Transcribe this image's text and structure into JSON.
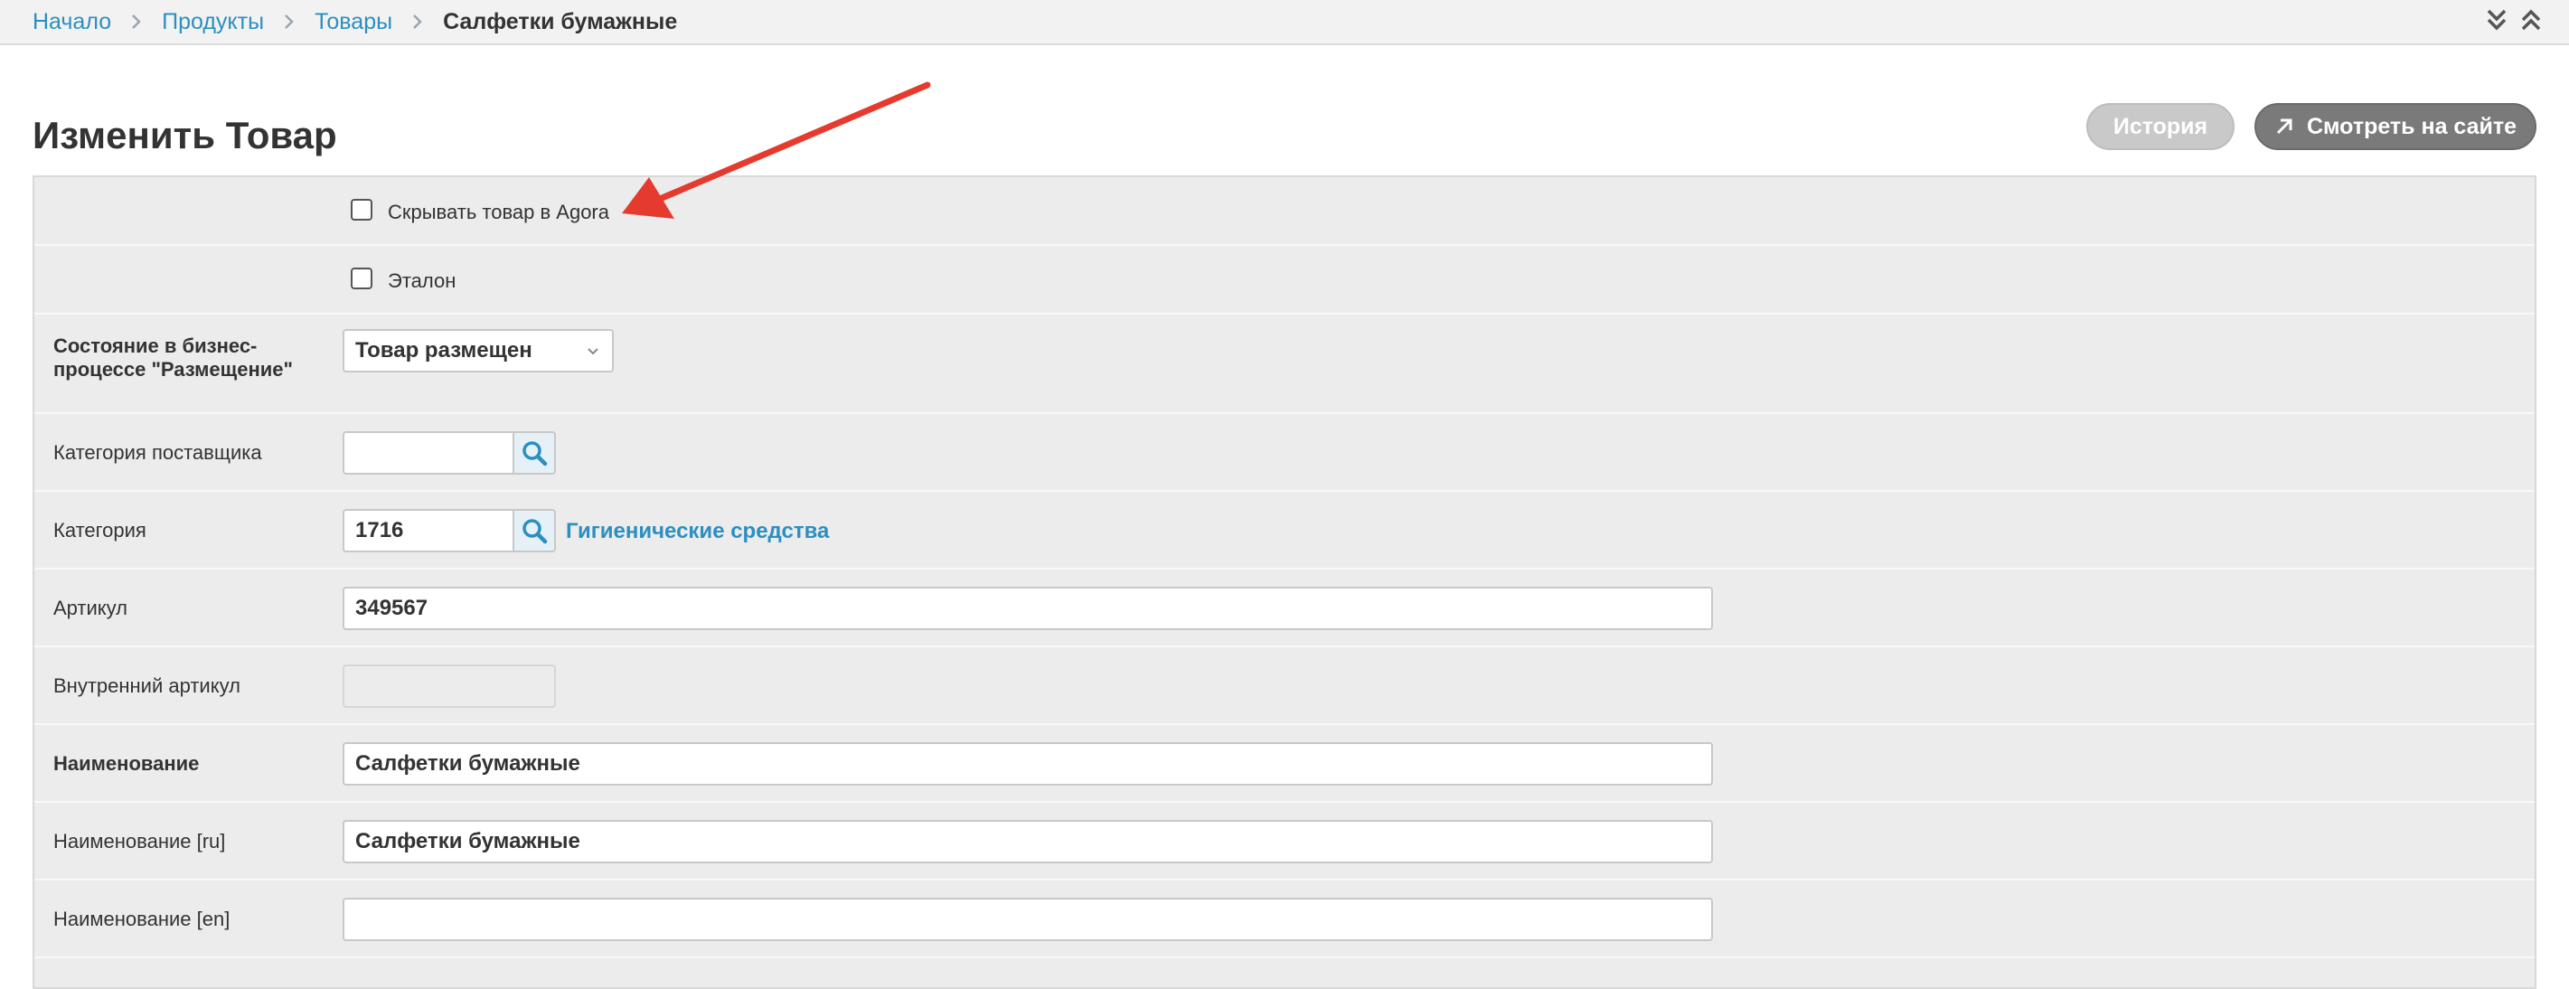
{
  "breadcrumb": {
    "items": [
      "Начало",
      "Продукты",
      "Товары"
    ],
    "current": "Салфетки бумажные"
  },
  "page": {
    "title": "Изменить Товар",
    "history_button": "История",
    "view_on_site_button": "Смотреть на сайте"
  },
  "form": {
    "hide_in_agora": {
      "label": "Скрывать товар в Agora",
      "checked": false
    },
    "etalon": {
      "label": "Эталон",
      "checked": false
    },
    "business_state": {
      "label": "Состояние в бизнес-процессе \"Размещение\"",
      "value": "Товар размещен"
    },
    "supplier_category": {
      "label": "Категория поставщика",
      "value": ""
    },
    "category": {
      "label": "Категория",
      "value": "1716",
      "link_text": "Гигиенические средства"
    },
    "article": {
      "label": "Артикул",
      "value": "349567"
    },
    "internal_article": {
      "label": "Внутренний артикул",
      "value": ""
    },
    "name": {
      "label": "Наименование",
      "value": "Салфетки бумажные"
    },
    "name_ru": {
      "label": "Наименование [ru]",
      "value": "Салфетки бумажные"
    },
    "name_en": {
      "label": "Наименование [en]",
      "value": ""
    }
  },
  "colors": {
    "link": "#2c8fc0",
    "annotation_arrow": "#e53b2f",
    "view_button": "#7a7a7a",
    "history_button": "#c9c9c9"
  }
}
